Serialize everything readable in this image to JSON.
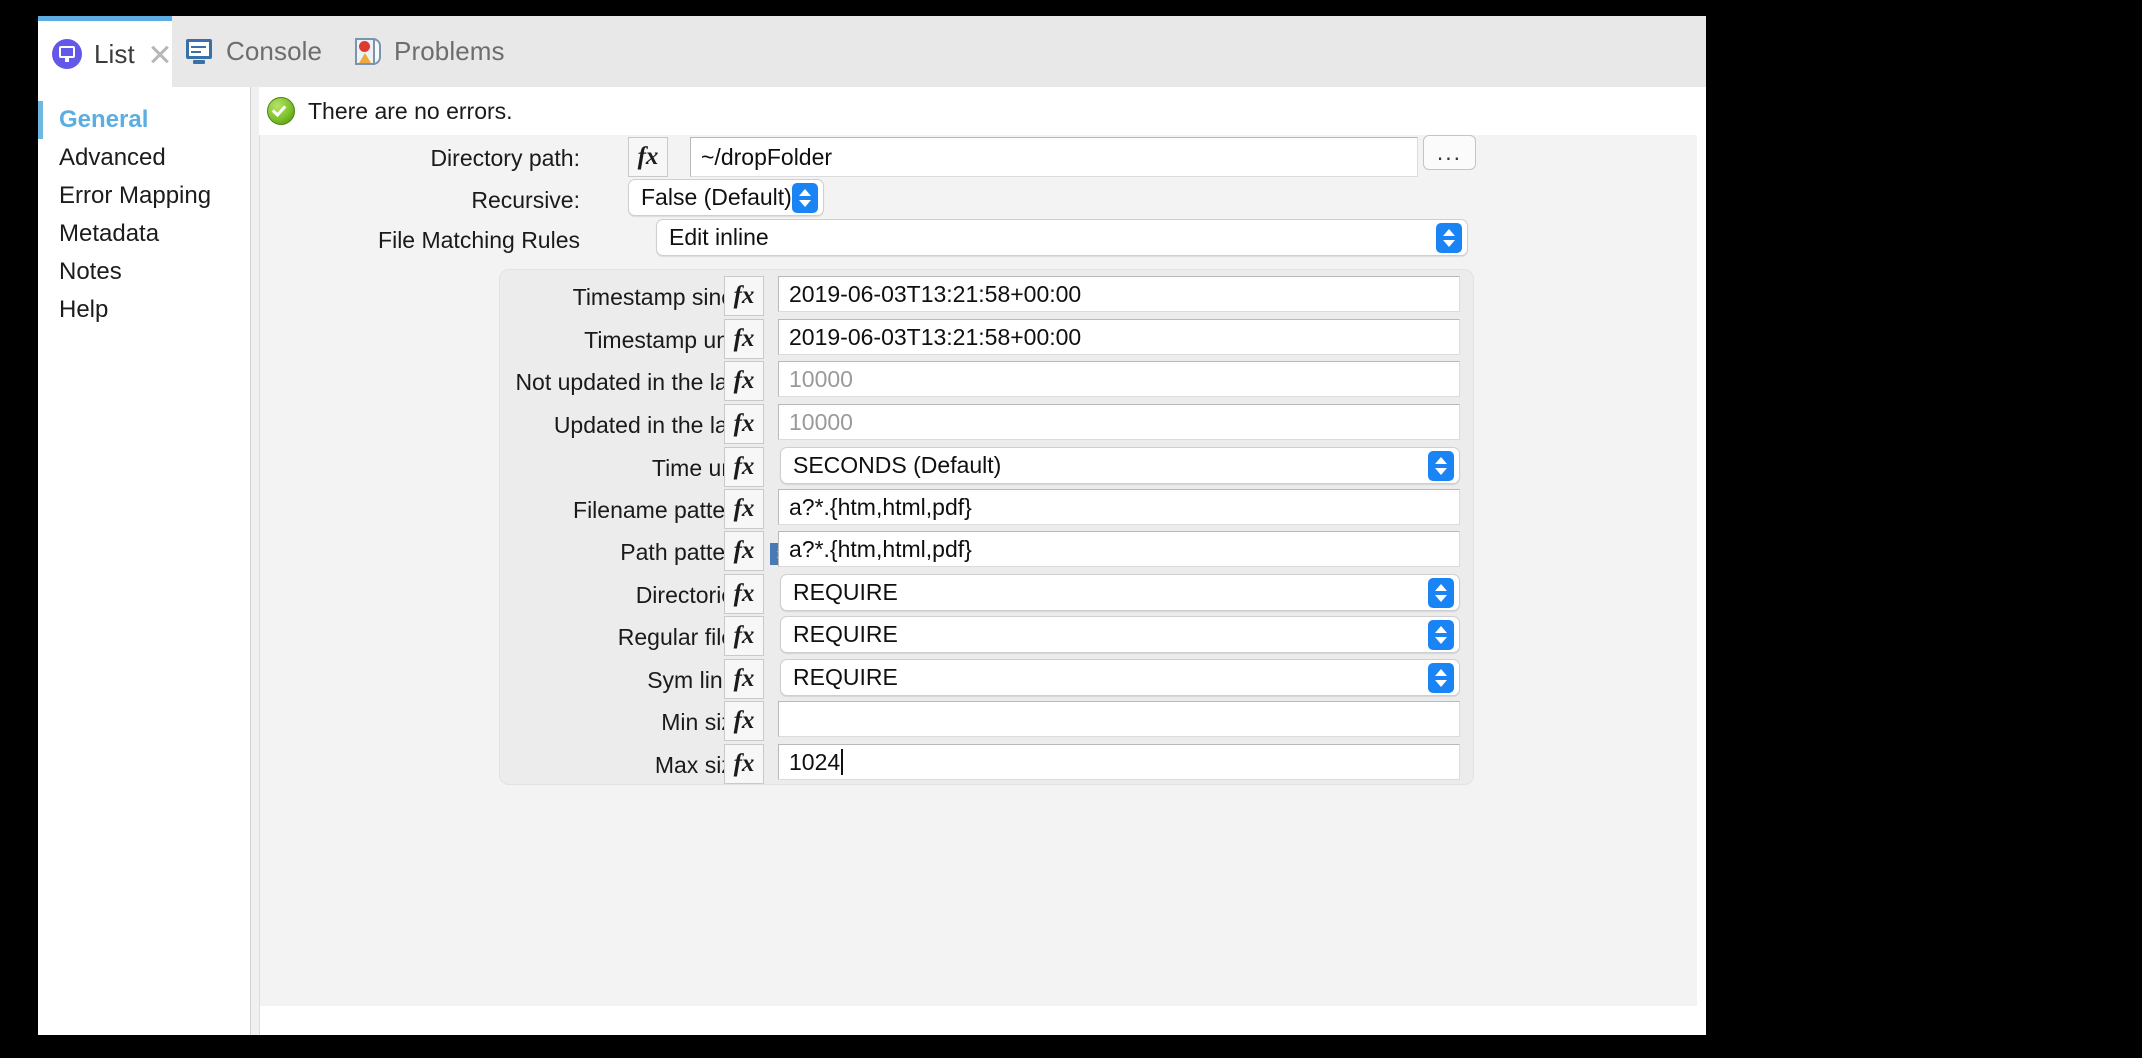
{
  "tabs": [
    {
      "label": "List",
      "icon": "list-icon",
      "active": true,
      "closable": true
    },
    {
      "label": "Console",
      "icon": "console-icon",
      "active": false,
      "closable": false
    },
    {
      "label": "Problems",
      "icon": "problems-icon",
      "active": false,
      "closable": false
    }
  ],
  "sidebar": {
    "items": [
      {
        "label": "General",
        "selected": true
      },
      {
        "label": "Advanced",
        "selected": false
      },
      {
        "label": "Error Mapping",
        "selected": false
      },
      {
        "label": "Metadata",
        "selected": false
      },
      {
        "label": "Notes",
        "selected": false
      },
      {
        "label": "Help",
        "selected": false
      }
    ]
  },
  "status": {
    "text": "There are no errors.",
    "icon": "success-check-icon",
    "color": "#7dc22a"
  },
  "form": {
    "fx_label": "fx",
    "browse_label": "...",
    "directory_path": {
      "label": "Directory path:",
      "value": "~/dropFolder"
    },
    "recursive": {
      "label": "Recursive:",
      "value": "False (Default)"
    },
    "file_matching_rules": {
      "label": "File Matching Rules",
      "value": "Edit inline"
    }
  },
  "rules": [
    {
      "label": "Timestamp since:",
      "type": "text",
      "value": "2019-06-03T13:21:58+00:00",
      "placeholder": false
    },
    {
      "label": "Timestamp until:",
      "type": "text",
      "value": "2019-06-03T13:21:58+00:00",
      "placeholder": false
    },
    {
      "label": "Not updated in the last:",
      "type": "text",
      "value": "10000",
      "placeholder": true
    },
    {
      "label": "Updated in the last:",
      "type": "text",
      "value": "10000",
      "placeholder": true
    },
    {
      "label": "Time unit:",
      "type": "popup",
      "value": "SECONDS (Default)"
    },
    {
      "label": "Filename pattern:",
      "type": "text",
      "value": "a?*.{htm,html,pdf}",
      "placeholder": false
    },
    {
      "label": "Path pattern:",
      "type": "text",
      "value": "a?*.{htm,html,pdf}",
      "placeholder": false,
      "info_badge": "i"
    },
    {
      "label": "Directories:",
      "type": "popup",
      "value": "REQUIRE"
    },
    {
      "label": "Regular files:",
      "type": "popup",
      "value": "REQUIRE"
    },
    {
      "label": "Sym links:",
      "type": "popup",
      "value": "REQUIRE"
    },
    {
      "label": "Min size:",
      "type": "text",
      "value": "",
      "placeholder": false
    },
    {
      "label": "Max size:",
      "type": "text",
      "value": "1024",
      "placeholder": false,
      "caret": true
    }
  ],
  "colors": {
    "accent": "#5dade2",
    "stepper_blue": "#1a84f5",
    "tab_icon_purple": "#6458e8"
  }
}
